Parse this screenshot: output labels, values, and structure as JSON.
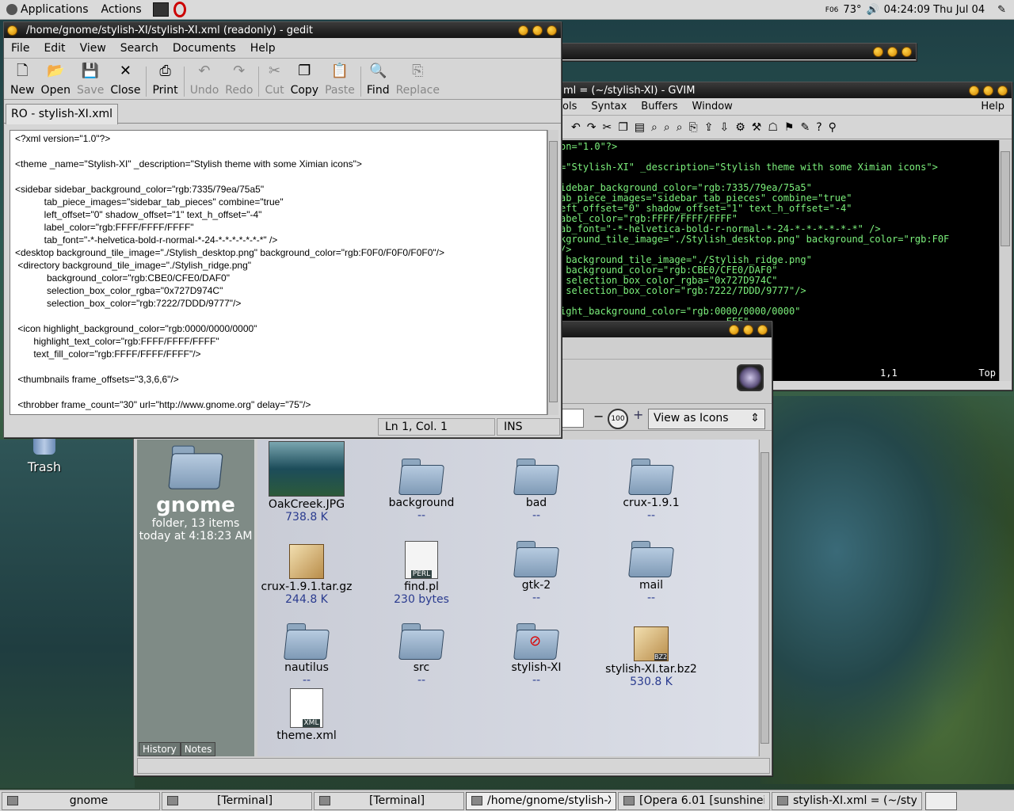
{
  "top_panel": {
    "applications": "Applications",
    "actions": "Actions",
    "tray": {
      "weather_code": "F06",
      "temperature": "73°",
      "clock": "04:24:09 Thu Jul 04"
    }
  },
  "desktop": {
    "trash_label": "Trash"
  },
  "gedit": {
    "title": "/home/gnome/stylish-XI/stylish-XI.xml (readonly) - gedit",
    "menu": [
      "File",
      "Edit",
      "View",
      "Search",
      "Documents",
      "Help"
    ],
    "toolbar": [
      {
        "label": "New",
        "icon": "new-icon",
        "enabled": true
      },
      {
        "label": "Open",
        "icon": "open-icon",
        "enabled": true
      },
      {
        "label": "Save",
        "icon": "save-icon",
        "enabled": false
      },
      {
        "label": "Close",
        "icon": "close-icon",
        "enabled": true
      },
      {
        "label": "Print",
        "icon": "print-icon",
        "enabled": true
      },
      {
        "label": "Undo",
        "icon": "undo-icon",
        "enabled": false
      },
      {
        "label": "Redo",
        "icon": "redo-icon",
        "enabled": false
      },
      {
        "label": "Cut",
        "icon": "cut-icon",
        "enabled": false
      },
      {
        "label": "Copy",
        "icon": "copy-icon",
        "enabled": true
      },
      {
        "label": "Paste",
        "icon": "paste-icon",
        "enabled": false
      },
      {
        "label": "Find",
        "icon": "find-icon",
        "enabled": true
      },
      {
        "label": "Replace",
        "icon": "replace-icon",
        "enabled": false
      }
    ],
    "tab": "RO - stylish-XI.xml",
    "content": "<?xml version=\"1.0\"?>\n\n<theme _name=\"Stylish-XI\" _description=\"Stylish theme with some Ximian icons\">\n\n<sidebar sidebar_background_color=\"rgb:7335/79ea/75a5\"\n           tab_piece_images=\"sidebar_tab_pieces\" combine=\"true\"\n           left_offset=\"0\" shadow_offset=\"1\" text_h_offset=\"-4\"\n           label_color=\"rgb:FFFF/FFFF/FFFF\"\n           tab_font=\"-*-helvetica-bold-r-normal-*-24-*-*-*-*-*-*-*\" />\n<desktop background_tile_image=\"./Stylish_desktop.png\" background_color=\"rgb:F0F0/F0F0/F0F0\"/>\n <directory background_tile_image=\"./Stylish_ridge.png\"\n            background_color=\"rgb:CBE0/CFE0/DAF0\"\n            selection_box_color_rgba=\"0x727D974C\"\n            selection_box_color=\"rgb:7222/7DDD/9777\"/>\n\n <icon highlight_background_color=\"rgb:0000/0000/0000\"\n       highlight_text_color=\"rgb:FFFF/FFFF/FFFF\"\n       text_fill_color=\"rgb:FFFF/FFFF/FFFF\"/>\n\n <thumbnails frame_offsets=\"3,3,6,6\"/>\n\n <throbber frame_count=\"30\" url=\"http://www.gnome.org\" delay=\"75\"/>",
    "status": {
      "position": "Ln 1, Col. 1",
      "mode": "INS"
    }
  },
  "terminal": {
    "title": "Terminal"
  },
  "gvim": {
    "title": "ml = (~/stylish-XI) - GVIM",
    "menu": [
      "ols",
      "Syntax",
      "Buffers",
      "Window"
    ],
    "help": "Help",
    "lines": [
      "on=\"1.0\"?>",
      "",
      "=\"Stylish-XI\" _description=\"Stylish theme with some Ximian icons\">",
      "",
      "idebar_background_color=\"rgb:7335/79ea/75a5\"",
      "ab_piece_images=\"sidebar_tab_pieces\" combine=\"true\"",
      "eft_offset=\"0\" shadow_offset=\"1\" text_h_offset=\"-4\"",
      "abel_color=\"rgb:FFFF/FFFF/FFFF\"",
      "ab_font=\"-*-helvetica-bold-r-normal-*-24-*-*-*-*-*-*\" />",
      "kground_tile_image=\"./Stylish_desktop.png\" background_color=\"rgb:F0F",
      "/>",
      " background_tile_image=\"./Stylish_ridge.png\"",
      " background_color=\"rgb:CBE0/CFE0/DAF0\"",
      " selection_box_color_rgba=\"0x727D974C\"",
      " selection_box_color=\"rgb:7222/7DDD/9777\"/>",
      "",
      "ight_background_color=\"rgb:0000/0000/0000\"",
      "                             FFF\""
    ],
    "ruler": "1,1",
    "ruler_pos": "Top"
  },
  "nautilus": {
    "view_as": "View as Icons",
    "zoom": "100",
    "sidebar": {
      "name": "gnome",
      "kind": "folder, 13 items",
      "date": "today at 4:18:23 AM",
      "tabs": [
        "History",
        "Notes"
      ]
    },
    "files": [
      {
        "name": "OakCreek.JPG",
        "size": "738.8 K",
        "type": "image"
      },
      {
        "name": "background",
        "size": "--",
        "type": "folder"
      },
      {
        "name": "bad",
        "size": "--",
        "type": "folder"
      },
      {
        "name": "crux-1.9.1",
        "size": "--",
        "type": "folder"
      },
      {
        "name": "crux-1.9.1.tar.gz",
        "size": "244.8 K",
        "type": "archive"
      },
      {
        "name": "find.pl",
        "size": "230 bytes",
        "type": "perl"
      },
      {
        "name": "gtk-2",
        "size": "--",
        "type": "folder"
      },
      {
        "name": "mail",
        "size": "--",
        "type": "folder"
      },
      {
        "name": "nautilus",
        "size": "--",
        "type": "folder"
      },
      {
        "name": "src",
        "size": "--",
        "type": "folder"
      },
      {
        "name": "stylish-XI",
        "size": "--",
        "type": "folder-locked"
      },
      {
        "name": "stylish-XI.tar.bz2",
        "size": "530.8 K",
        "type": "bz2"
      },
      {
        "name": "theme.xml",
        "size": "",
        "type": "xml"
      }
    ]
  },
  "taskbar": [
    {
      "label": "gnome",
      "active": false
    },
    {
      "label": "[Terminal]",
      "active": false
    },
    {
      "label": "[Terminal]",
      "active": false
    },
    {
      "label": "/home/gnome/stylish-XI/st",
      "active": true
    },
    {
      "label": "[Opera 6.01  [sunshineinat",
      "active": false
    },
    {
      "label": "stylish-XI.xml = (~/stylish-",
      "active": false
    }
  ]
}
